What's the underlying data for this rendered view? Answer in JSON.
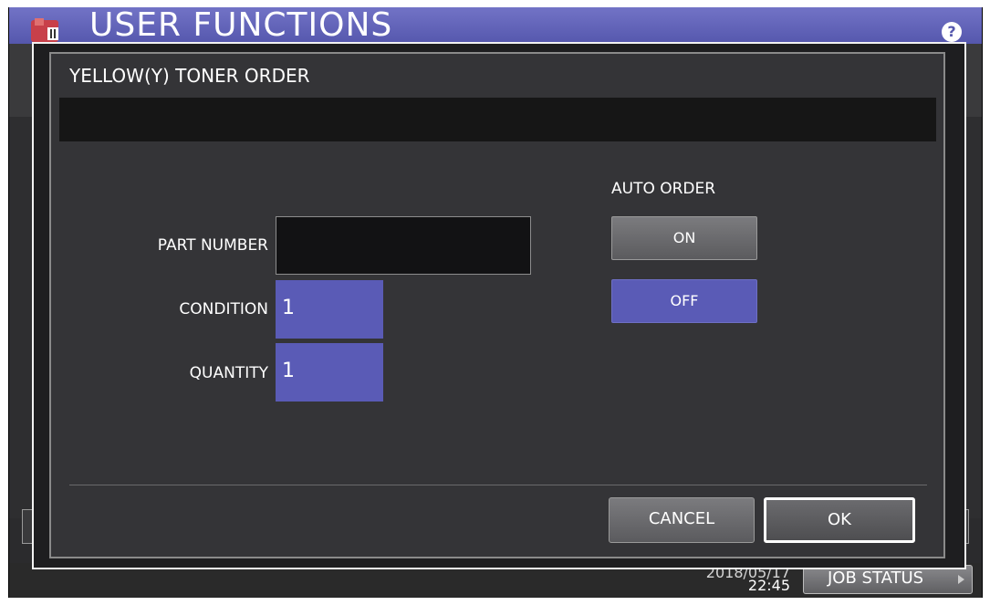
{
  "app": {
    "title": "USER FUNCTIONS",
    "help_label": "?"
  },
  "status_bar": {
    "date": "2018/05/17",
    "time": "22:45",
    "job_status_label": "JOB STATUS"
  },
  "dialog": {
    "title": "YELLOW(Y) TONER ORDER",
    "message": "",
    "part_number_label": "PART NUMBER",
    "part_number_value": "",
    "condition_label": "CONDITION",
    "condition_value": "1",
    "quantity_label": "QUANTITY",
    "quantity_value": "1",
    "auto_order_label": "AUTO ORDER",
    "auto_order_on_label": "ON",
    "auto_order_off_label": "OFF",
    "auto_order_selected": "OFF",
    "cancel_label": "CANCEL",
    "ok_label": "OK"
  },
  "colors": {
    "header": "#5557ad",
    "selected": "#5a5bb6",
    "dialog_bg": "#343437"
  },
  "icons": {
    "app": "user-functions-icon",
    "help": "help-icon",
    "job_status_arrow": "play-arrow-icon"
  }
}
